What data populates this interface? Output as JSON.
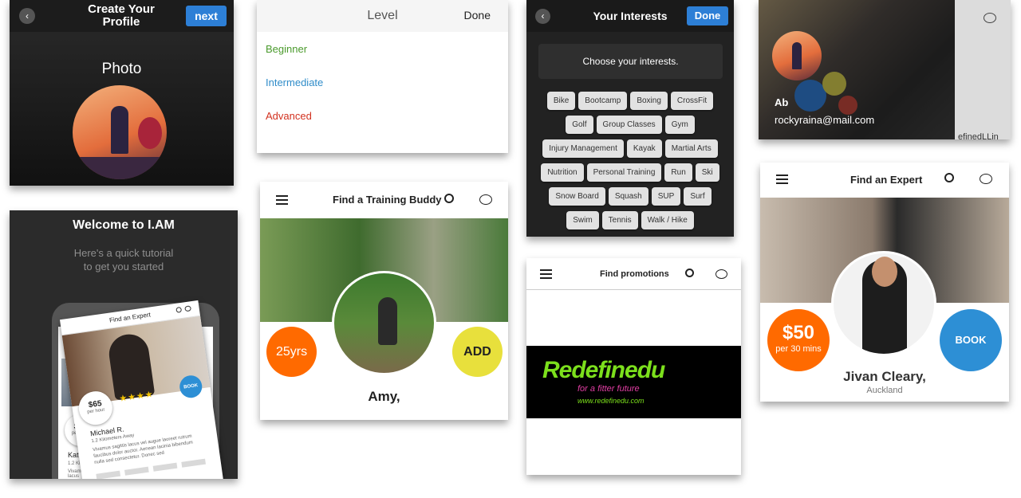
{
  "profile": {
    "title": "Create Your Profile",
    "next_label": "next",
    "photo_label": "Photo"
  },
  "level": {
    "title": "Level",
    "done_label": "Done",
    "options": [
      "Beginner",
      "Intermediate",
      "Advanced"
    ],
    "colors": [
      "#4a9a2c",
      "#2f8cc9",
      "#d2311f"
    ]
  },
  "interests": {
    "title": "Your Interests",
    "done_label": "Done",
    "prompt": "Choose your interests.",
    "rows": [
      [
        "Bike",
        "Bootcamp",
        "Boxing",
        "CrossFit"
      ],
      [
        "Golf",
        "Group Classes",
        "Gym"
      ],
      [
        "Injury Management",
        "Kayak",
        "Martial Arts"
      ],
      [
        "Nutrition",
        "Personal Training",
        "Run",
        "Ski"
      ],
      [
        "Snow Board",
        "Squash",
        "SUP",
        "Surf"
      ],
      [
        "Swim",
        "Tennis",
        "Walk / Hike"
      ]
    ]
  },
  "account": {
    "name": "Ab",
    "email": "rockyraina@mail.com",
    "partial_text": "efinedLLin"
  },
  "welcome": {
    "title": "Welcome to I.AM",
    "subtitle_line1": "Here's a quick tutorial",
    "subtitle_line2": "to get you started",
    "mini": {
      "title": "Find an Expert",
      "price": "$65",
      "price_unit": "per hour",
      "book_label": "BOOK",
      "name": "Michael R.",
      "distance": "1.2 Kilometers Away",
      "bio": "Vivamus sagittis lacus vel augue laoreet rutrum faucibus dolor auctor. Aenean lacinia bibendum nulla sed consectetur. Donec sed",
      "price2": "$70",
      "price2_unit": "per hour",
      "name2": "Kate J.",
      "distance2": "1.2 Kilometers Away",
      "bio2": "Vivamus sagittis lacus"
    }
  },
  "buddy": {
    "title": "Find a Training Buddy",
    "age": "25yrs",
    "add_label": "ADD",
    "name": "Amy,"
  },
  "promotions": {
    "title": "Find promotions",
    "brand": "Redefinedu",
    "tagline": "for a fitter future",
    "url": "www.redefinedu.com"
  },
  "expert": {
    "title": "Find an Expert",
    "price": "$50",
    "price_unit": "per 30 mins",
    "book_label": "BOOK",
    "name": "Jivan Cleary,",
    "location": "Auckland"
  },
  "colors": {
    "orange": "#ff6a00",
    "yellow": "#e8e03c",
    "blue": "#2d8fd5",
    "brand_green": "#7ce01c"
  }
}
